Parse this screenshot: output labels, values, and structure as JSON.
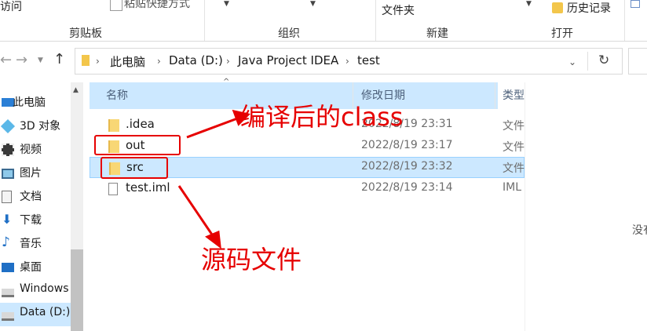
{
  "ribbon": {
    "access_label": "访问",
    "paste_shortcut_label": "粘贴快捷方式",
    "folder_label": "文件夹",
    "history_label": "历史记录",
    "groups": {
      "clipboard": "剪贴板",
      "organize": "组织",
      "new": "新建",
      "open": "打开"
    }
  },
  "address": {
    "crumbs": [
      "此电脑",
      "Data (D:)",
      "Java Project IDEA",
      "test"
    ]
  },
  "sidebar": {
    "items": [
      {
        "label": "此电脑",
        "icon": "pc-icon"
      },
      {
        "label": "3D 对象",
        "icon": "3d-objects-icon"
      },
      {
        "label": "视频",
        "icon": "video-icon"
      },
      {
        "label": "图片",
        "icon": "pictures-icon"
      },
      {
        "label": "文档",
        "icon": "documents-icon"
      },
      {
        "label": "下载",
        "icon": "download-icon"
      },
      {
        "label": "音乐",
        "icon": "music-icon"
      },
      {
        "label": "桌面",
        "icon": "desktop-icon"
      },
      {
        "label": "Windows",
        "icon": "drive-icon"
      },
      {
        "label": "Data (D:)",
        "icon": "drive-icon"
      }
    ]
  },
  "file_list": {
    "columns": {
      "name": "名称",
      "date": "修改日期",
      "type": "类型"
    },
    "rows": [
      {
        "name": ".idea",
        "date": "2022/8/19 23:31",
        "type": "文件",
        "icon": "folder-icon"
      },
      {
        "name": "out",
        "date": "2022/8/19 23:17",
        "type": "文件",
        "icon": "folder-icon"
      },
      {
        "name": "src",
        "date": "2022/8/19 23:32",
        "type": "文件",
        "icon": "folder-icon"
      },
      {
        "name": "test.iml",
        "date": "2022/8/19 23:14",
        "type": "IML",
        "icon": "file-icon"
      }
    ]
  },
  "right_pane": {
    "text": "没有"
  },
  "annotations": {
    "compiled_label": "编译后的class",
    "source_label": "源码文件"
  },
  "colors": {
    "selection": "#cce8ff",
    "annotation": "#e60000",
    "folder": "#f8d775"
  }
}
